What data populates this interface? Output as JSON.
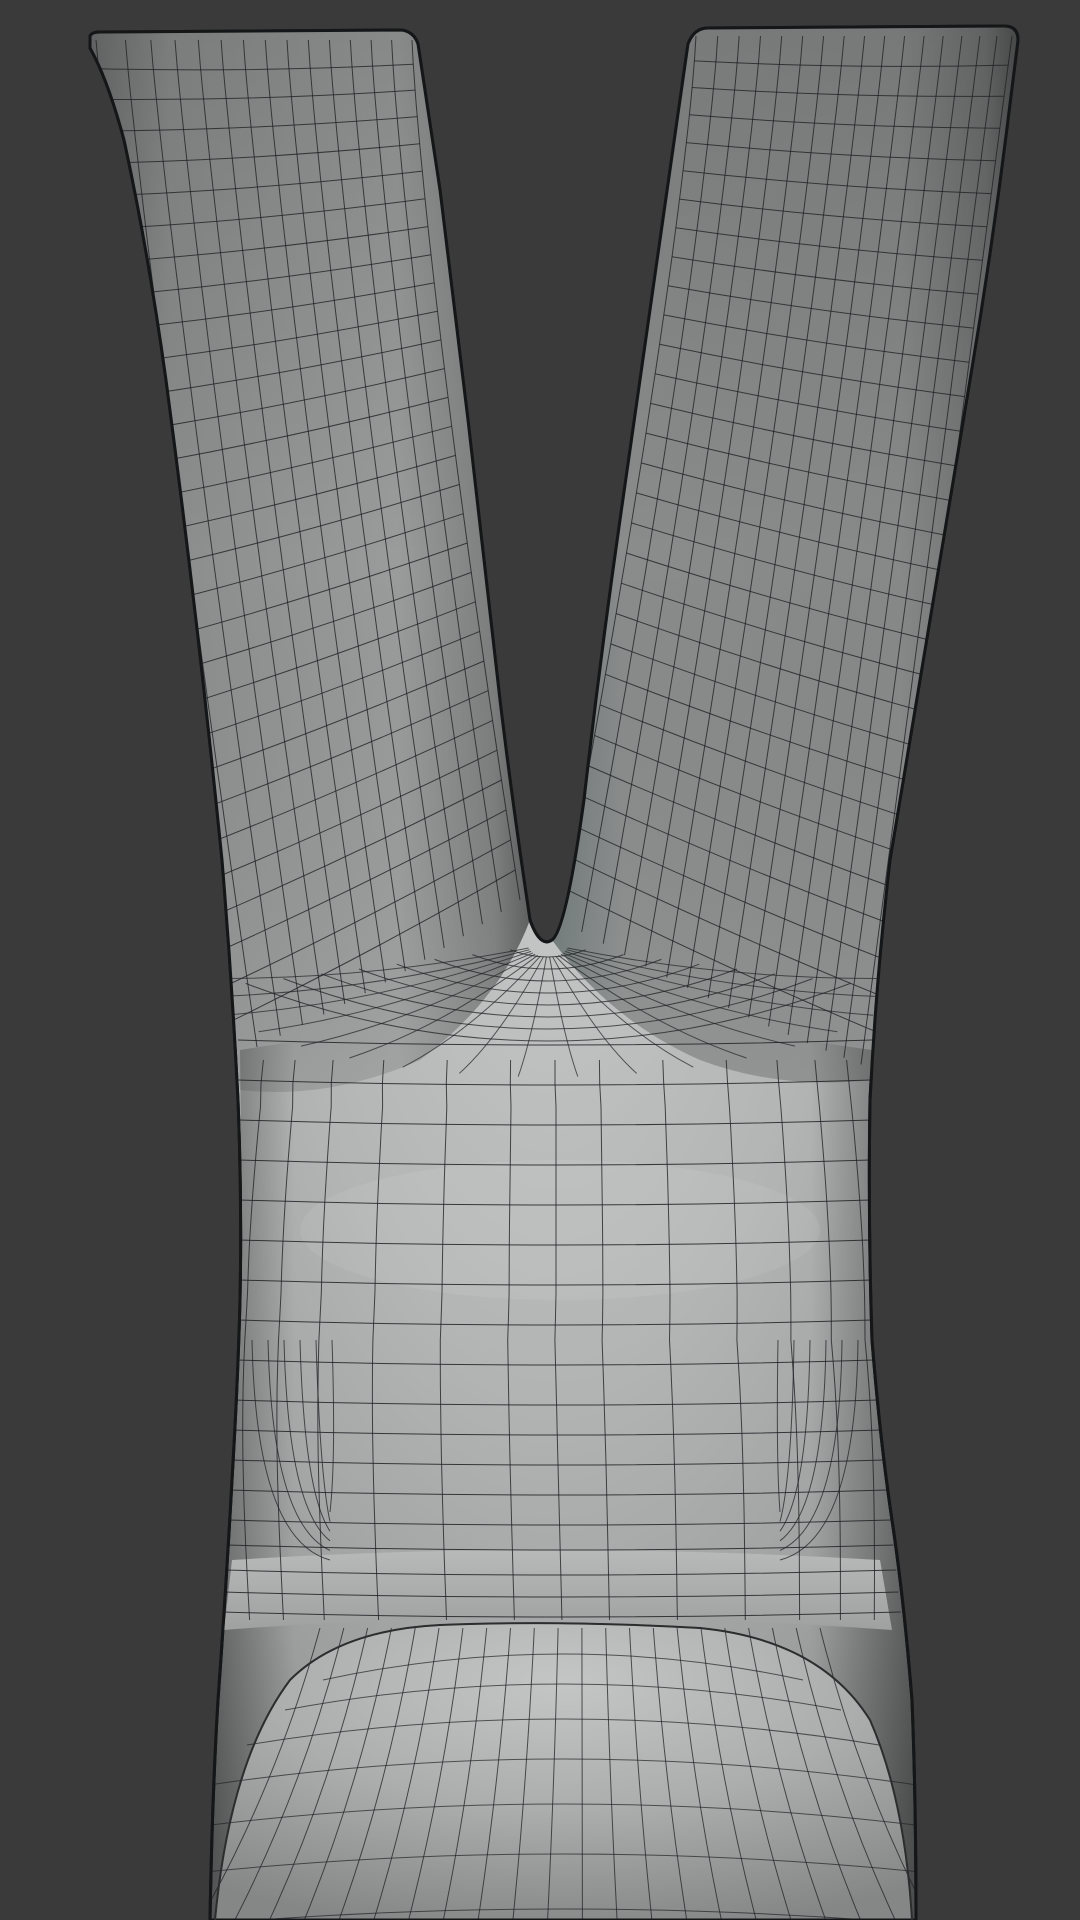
{
  "viewport": {
    "background_color": "#3a3a3a",
    "mesh_light_color": "#c8c9c9",
    "mesh_mid_color": "#8d8f8f",
    "mesh_dark_color": "#5b5d5e",
    "wire_color": "#1f2224"
  },
  "object": {
    "kind": "subdivided-mesh-wireframe",
    "shape": "y-fork"
  }
}
